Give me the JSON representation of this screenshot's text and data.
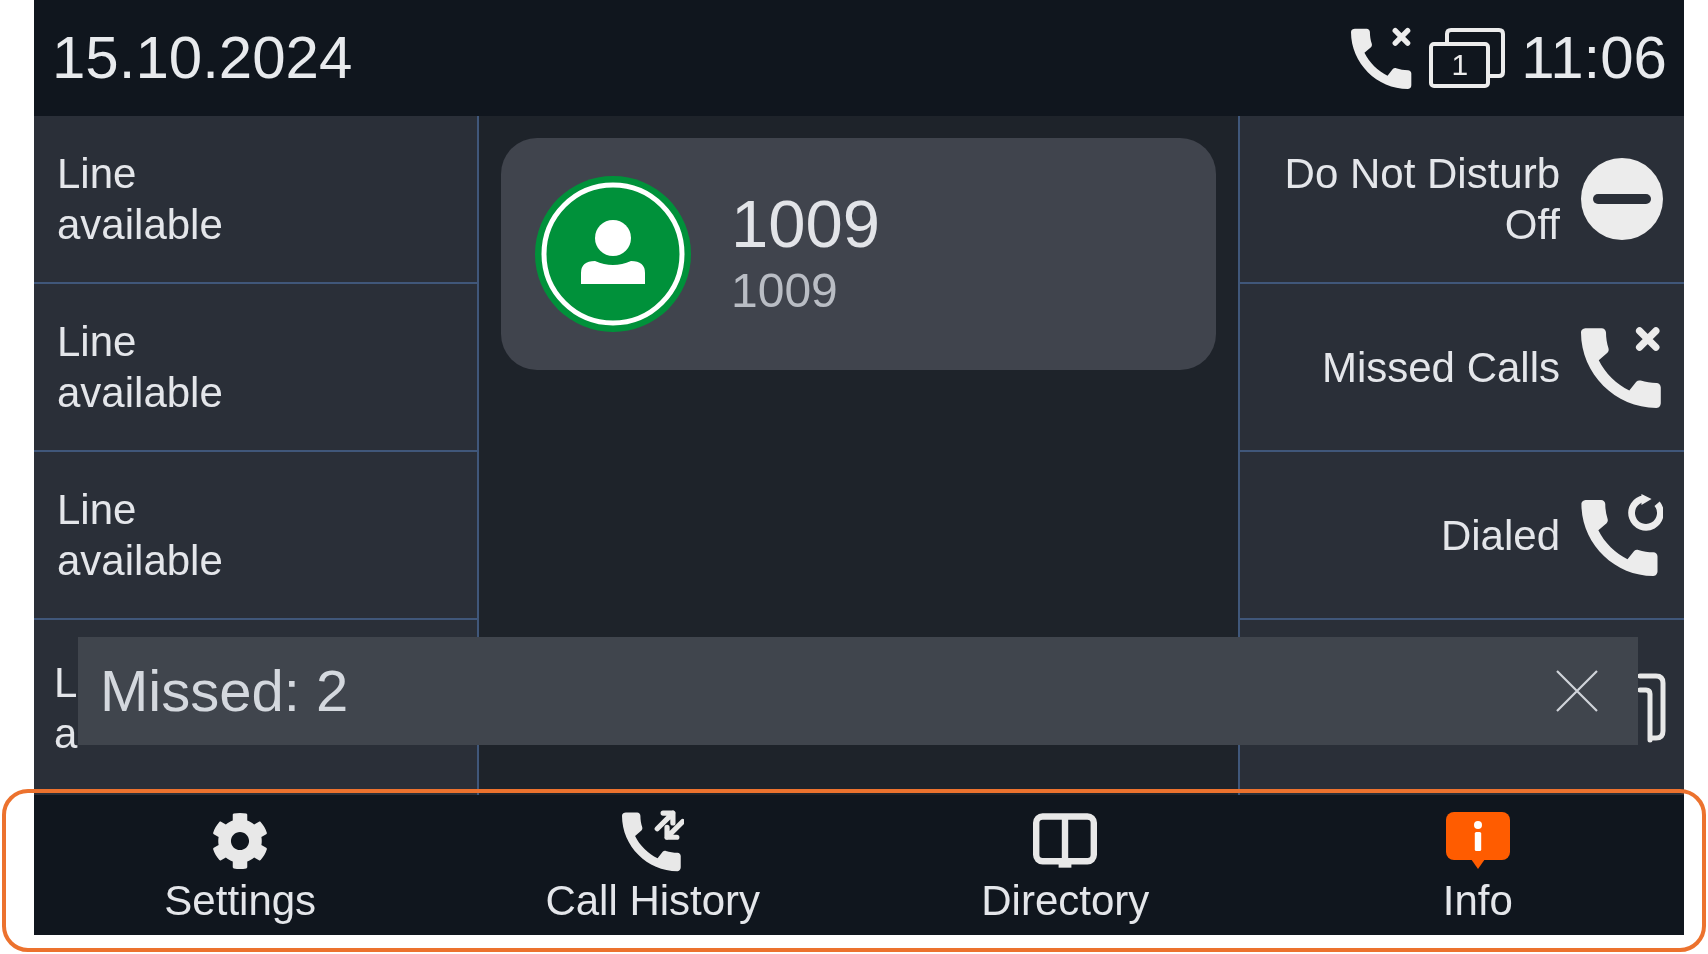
{
  "status_bar": {
    "date": "15.10.2024",
    "missed_call_alert": true,
    "line_number": "1",
    "time": "11:06"
  },
  "lines": [
    {
      "label": "Line",
      "status": "available"
    },
    {
      "label": "Line",
      "status": "available"
    },
    {
      "label": "Line",
      "status": "available"
    },
    {
      "label": "L",
      "status": "a"
    }
  ],
  "call": {
    "name": "1009",
    "number": "1009"
  },
  "shortcuts": [
    {
      "kind": "dnd",
      "label": "Do Not Disturb",
      "value": "Off"
    },
    {
      "kind": "missed",
      "label": "Missed Calls"
    },
    {
      "kind": "dialed",
      "label": "Dialed"
    },
    {
      "kind": "lines"
    }
  ],
  "notification": {
    "text": "Missed: 2"
  },
  "softkeys": [
    {
      "kind": "settings",
      "label": "Settings"
    },
    {
      "kind": "history",
      "label": "Call History"
    },
    {
      "kind": "directory",
      "label": "Directory"
    },
    {
      "kind": "info",
      "label": "Info"
    }
  ]
}
